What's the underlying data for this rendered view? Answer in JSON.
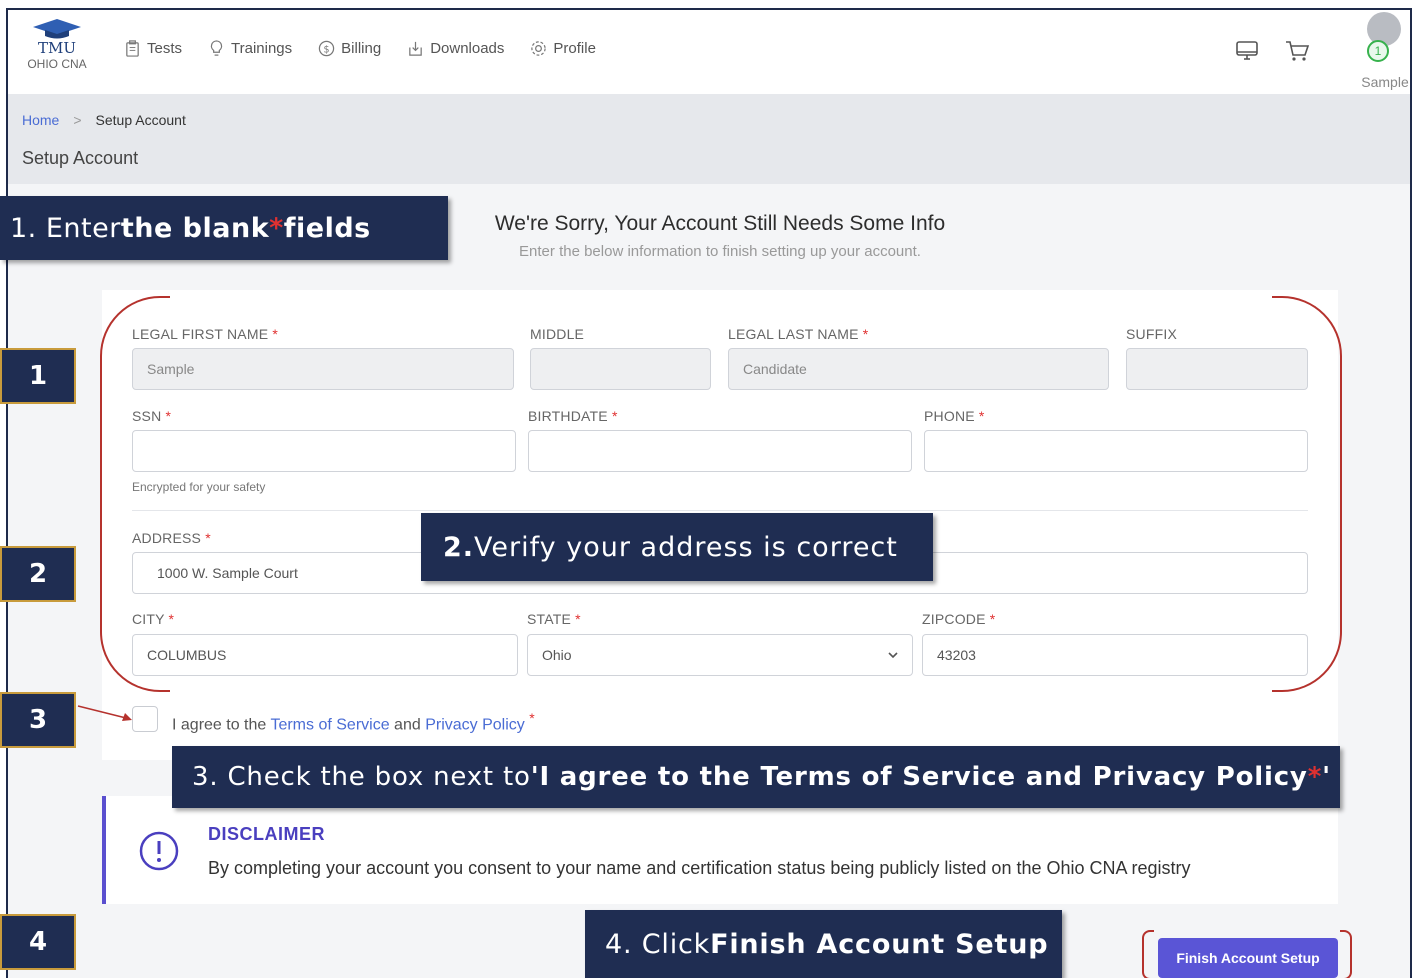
{
  "logo": {
    "line1": "TMU",
    "line2": "OHIO CNA"
  },
  "nav": {
    "items": [
      {
        "label": "Tests",
        "icon": "clipboard-icon"
      },
      {
        "label": "Trainings",
        "icon": "lightbulb-icon"
      },
      {
        "label": "Billing",
        "icon": "dollar-icon"
      },
      {
        "label": "Downloads",
        "icon": "download-icon"
      },
      {
        "label": "Profile",
        "icon": "gear-icon"
      }
    ],
    "user_name": "Sample",
    "notification_count": "1"
  },
  "breadcrumb": {
    "home": "Home",
    "separator": ">",
    "current": "Setup Account"
  },
  "page_title": "Setup Account",
  "heading": {
    "title": "We're Sorry, Your Account Still Needs Some Info",
    "subtitle": "Enter the below information to finish setting up your account."
  },
  "form": {
    "required_mark": "*",
    "first_name": {
      "label": "LEGAL FIRST NAME",
      "value": "Sample"
    },
    "middle": {
      "label": "MIDDLE",
      "value": ""
    },
    "last_name": {
      "label": "LEGAL LAST NAME",
      "value": "Candidate"
    },
    "suffix": {
      "label": "SUFFIX",
      "value": ""
    },
    "ssn": {
      "label": "SSN",
      "value": "",
      "hint": "Encrypted for your safety"
    },
    "birthdate": {
      "label": "BIRTHDATE",
      "value": ""
    },
    "phone": {
      "label": "PHONE",
      "value": ""
    },
    "address": {
      "label": "ADDRESS",
      "value": "1000 W. Sample Court"
    },
    "city": {
      "label": "CITY",
      "value": "COLUMBUS"
    },
    "state": {
      "label": "STATE",
      "value": "Ohio"
    },
    "zipcode": {
      "label": "ZIPCODE",
      "value": "43203"
    },
    "agree": {
      "prefix": "I agree to the",
      "terms": "Terms of Service",
      "and": "and",
      "privacy": "Privacy Policy"
    }
  },
  "disclaimer": {
    "title": "DISCLAIMER",
    "body": "By completing your account you consent to your name and certification status being publicly listed on the Ohio CNA registry"
  },
  "finish_button": "Finish Account Setup",
  "callouts": {
    "step1": {
      "pre": "1. Enter ",
      "bold": "the blank ",
      "star": "*",
      "post": " fields"
    },
    "step2": {
      "num": "2.",
      "text": " Verify your address is correct"
    },
    "step3": {
      "pre": "3.  Check the box next to ",
      "bold": "'I agree to the Terms of Service and Privacy Policy ",
      "star": "*",
      "end": "'"
    },
    "step4": {
      "pre": "4. Click ",
      "bold": "Finish Account Setup"
    }
  },
  "step_badges": [
    "1",
    "2",
    "3",
    "4"
  ],
  "colors": {
    "accent": "#5a55d6",
    "callout_bg": "#1f2d52",
    "required": "#e03131",
    "link": "#4a6cd4",
    "annotation": "#b5322d"
  }
}
